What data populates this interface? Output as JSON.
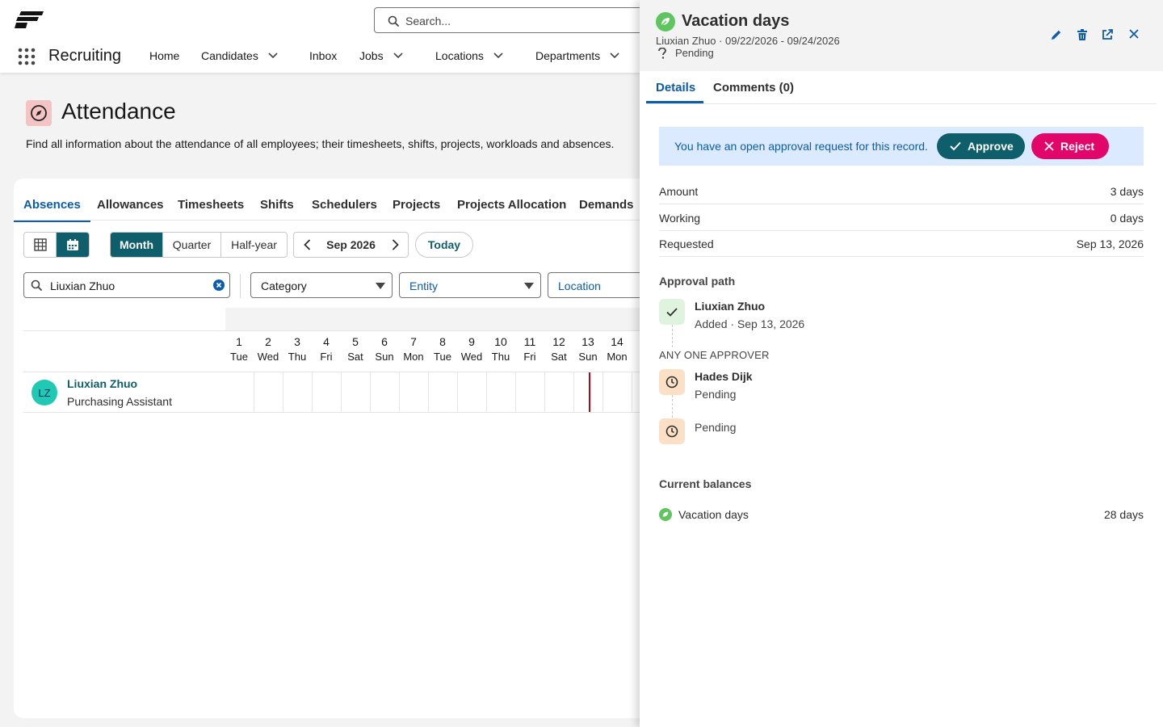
{
  "header": {
    "search_placeholder": "Search...",
    "app_name": "Recruiting",
    "nav": [
      {
        "label": "Home"
      },
      {
        "label": "Candidates"
      },
      {
        "label": "Inbox"
      },
      {
        "label": "Jobs"
      },
      {
        "label": "Locations"
      },
      {
        "label": "Departments"
      }
    ]
  },
  "page": {
    "title": "Attendance",
    "description": "Find all information about the attendance of all employees; their timesheets, shifts, projects, workloads and absences."
  },
  "main": {
    "tabs": [
      "Absences",
      "Allowances",
      "Timesheets",
      "Shifts",
      "Schedulers",
      "Projects",
      "Projects Allocation",
      "Demands"
    ],
    "active_tab": "Absences",
    "views": [
      "Month",
      "Quarter",
      "Half-year"
    ],
    "active_view": "Month",
    "period": "Sep 2026",
    "today_label": "Today",
    "filter_search_value": "Liuxian Zhuo",
    "filters": [
      "Category",
      "Entity",
      "Location"
    ],
    "days": [
      {
        "n": "1",
        "w": "Tue"
      },
      {
        "n": "2",
        "w": "Wed"
      },
      {
        "n": "3",
        "w": "Thu"
      },
      {
        "n": "4",
        "w": "Fri"
      },
      {
        "n": "5",
        "w": "Sat"
      },
      {
        "n": "6",
        "w": "Sun"
      },
      {
        "n": "7",
        "w": "Mon"
      },
      {
        "n": "8",
        "w": "Tue"
      },
      {
        "n": "9",
        "w": "Wed"
      },
      {
        "n": "10",
        "w": "Thu"
      },
      {
        "n": "11",
        "w": "Fri"
      },
      {
        "n": "12",
        "w": "Sat"
      },
      {
        "n": "13",
        "w": "Sun"
      },
      {
        "n": "14",
        "w": "Mon"
      }
    ],
    "employee": {
      "initials": "LZ",
      "name": "Liuxian Zhuo",
      "role": "Purchasing Assistant"
    }
  },
  "panel": {
    "title": "Vacation days",
    "subtitle": "Liuxian Zhuo · 09/22/2026 - 09/24/2026",
    "status": "Pending",
    "tabs": [
      "Details",
      "Comments (0)"
    ],
    "approval_text": "You have an open approval request for this record.",
    "approve_label": "Approve",
    "reject_label": "Reject",
    "fields": [
      {
        "k": "Amount",
        "v": "3 days"
      },
      {
        "k": "Working",
        "v": "0 days"
      },
      {
        "k": "Requested",
        "v": "Sep 13, 2026"
      }
    ],
    "approval_path_title": "Approval path",
    "steps": {
      "first_name": "Liuxian Zhuo",
      "first_meta": "Added · Sep 13, 2026",
      "group_label": "ANY ONE APPROVER",
      "second_name": "Hades Dijk",
      "second_meta": "Pending",
      "third_meta": "Pending"
    },
    "balances_title": "Current balances",
    "balance": {
      "name": "Vacation days",
      "value": "28 days"
    }
  },
  "colors": {
    "primary": "#0e5f6b",
    "brand_blue": "#0b5cab",
    "reject": "#e3066a",
    "today_marker": "#ba0517",
    "vacation_green": "#5fc65f"
  }
}
